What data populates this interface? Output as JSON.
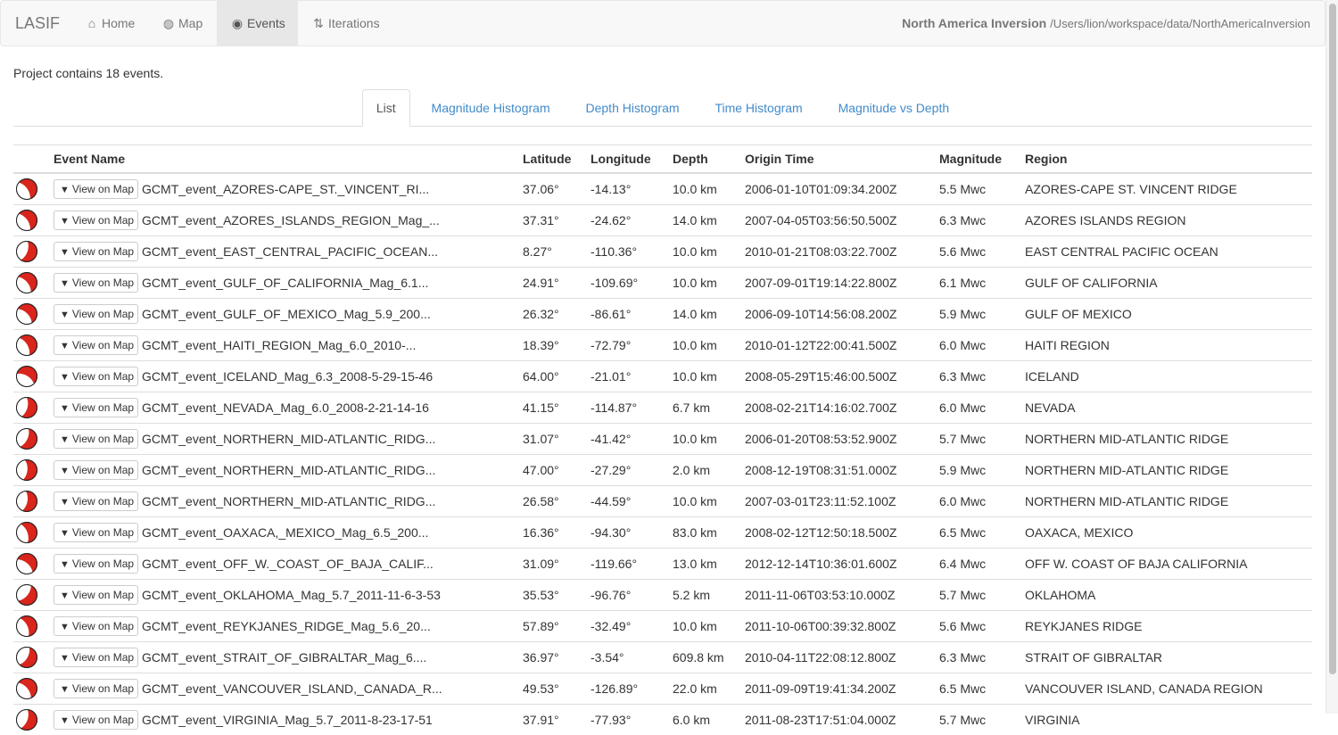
{
  "navbar": {
    "brand": "LASIF",
    "items": [
      {
        "label": "Home",
        "icon": "home-icon",
        "glyph": "⌂"
      },
      {
        "label": "Map",
        "icon": "globe-icon",
        "glyph": "◍"
      },
      {
        "label": "Events",
        "icon": "target-icon",
        "glyph": "◉"
      },
      {
        "label": "Iterations",
        "icon": "sort-icon",
        "glyph": "⇅"
      }
    ],
    "active": "Events",
    "project_name": "North America Inversion",
    "project_path": "/Users/lion/workspace/data/NorthAmericaInversion"
  },
  "summary": "Project contains 18 events.",
  "tabs": [
    "List",
    "Magnitude Histogram",
    "Depth Histogram",
    "Time Histogram",
    "Magnitude vs Depth"
  ],
  "active_tab": "List",
  "table": {
    "columns": [
      "",
      "Event Name",
      "Latitude",
      "Longitude",
      "Depth",
      "Origin Time",
      "Magnitude",
      "Region"
    ],
    "view_button_label": "View on Map",
    "colors": {
      "beachball_red": "#d9251c",
      "beachball_white": "#ffffff",
      "beachball_outline": "#222222"
    },
    "rows": [
      {
        "name": "GCMT_event_AZORES-CAPE_ST._VINCENT_RI...",
        "lat": "37.06°",
        "lon": "-14.13°",
        "depth": "10.0 km",
        "time": "2006-01-10T01:09:34.200Z",
        "mag": "5.5 Mwc",
        "region": "AZORES-CAPE ST. VINCENT RIDGE"
      },
      {
        "name": "GCMT_event_AZORES_ISLANDS_REGION_Mag_...",
        "lat": "37.31°",
        "lon": "-24.62°",
        "depth": "14.0 km",
        "time": "2007-04-05T03:56:50.500Z",
        "mag": "6.3 Mwc",
        "region": "AZORES ISLANDS REGION"
      },
      {
        "name": "GCMT_event_EAST_CENTRAL_PACIFIC_OCEAN...",
        "lat": "8.27°",
        "lon": "-110.36°",
        "depth": "10.0 km",
        "time": "2010-01-21T08:03:22.700Z",
        "mag": "5.6 Mwc",
        "region": "EAST CENTRAL PACIFIC OCEAN"
      },
      {
        "name": "GCMT_event_GULF_OF_CALIFORNIA_Mag_6.1...",
        "lat": "24.91°",
        "lon": "-109.69°",
        "depth": "10.0 km",
        "time": "2007-09-01T19:14:22.800Z",
        "mag": "6.1 Mwc",
        "region": "GULF OF CALIFORNIA"
      },
      {
        "name": "GCMT_event_GULF_OF_MEXICO_Mag_5.9_200...",
        "lat": "26.32°",
        "lon": "-86.61°",
        "depth": "14.0 km",
        "time": "2006-09-10T14:56:08.200Z",
        "mag": "5.9 Mwc",
        "region": "GULF OF MEXICO"
      },
      {
        "name": "GCMT_event_HAITI_REGION_Mag_6.0_2010-...",
        "lat": "18.39°",
        "lon": "-72.79°",
        "depth": "10.0 km",
        "time": "2010-01-12T22:00:41.500Z",
        "mag": "6.0 Mwc",
        "region": "HAITI REGION"
      },
      {
        "name": "GCMT_event_ICELAND_Mag_6.3_2008-5-29-15-46",
        "lat": "64.00°",
        "lon": "-21.01°",
        "depth": "10.0 km",
        "time": "2008-05-29T15:46:00.500Z",
        "mag": "6.3 Mwc",
        "region": "ICELAND"
      },
      {
        "name": "GCMT_event_NEVADA_Mag_6.0_2008-2-21-14-16",
        "lat": "41.15°",
        "lon": "-114.87°",
        "depth": "6.7 km",
        "time": "2008-02-21T14:16:02.700Z",
        "mag": "6.0 Mwc",
        "region": "NEVADA"
      },
      {
        "name": "GCMT_event_NORTHERN_MID-ATLANTIC_RIDG...",
        "lat": "31.07°",
        "lon": "-41.42°",
        "depth": "10.0 km",
        "time": "2006-01-20T08:53:52.900Z",
        "mag": "5.7 Mwc",
        "region": "NORTHERN MID-ATLANTIC RIDGE"
      },
      {
        "name": "GCMT_event_NORTHERN_MID-ATLANTIC_RIDG...",
        "lat": "47.00°",
        "lon": "-27.29°",
        "depth": "2.0 km",
        "time": "2008-12-19T08:31:51.000Z",
        "mag": "5.9 Mwc",
        "region": "NORTHERN MID-ATLANTIC RIDGE"
      },
      {
        "name": "GCMT_event_NORTHERN_MID-ATLANTIC_RIDG...",
        "lat": "26.58°",
        "lon": "-44.59°",
        "depth": "10.0 km",
        "time": "2007-03-01T23:11:52.100Z",
        "mag": "6.0 Mwc",
        "region": "NORTHERN MID-ATLANTIC RIDGE"
      },
      {
        "name": "GCMT_event_OAXACA,_MEXICO_Mag_6.5_200...",
        "lat": "16.36°",
        "lon": "-94.30°",
        "depth": "83.0 km",
        "time": "2008-02-12T12:50:18.500Z",
        "mag": "6.5 Mwc",
        "region": "OAXACA, MEXICO"
      },
      {
        "name": "GCMT_event_OFF_W._COAST_OF_BAJA_CALIF...",
        "lat": "31.09°",
        "lon": "-119.66°",
        "depth": "13.0 km",
        "time": "2012-12-14T10:36:01.600Z",
        "mag": "6.4 Mwc",
        "region": "OFF W. COAST OF BAJA CALIFORNIA"
      },
      {
        "name": "GCMT_event_OKLAHOMA_Mag_5.7_2011-11-6-3-53",
        "lat": "35.53°",
        "lon": "-96.76°",
        "depth": "5.2 km",
        "time": "2011-11-06T03:53:10.000Z",
        "mag": "5.7 Mwc",
        "region": "OKLAHOMA"
      },
      {
        "name": "GCMT_event_REYKJANES_RIDGE_Mag_5.6_20...",
        "lat": "57.89°",
        "lon": "-32.49°",
        "depth": "10.0 km",
        "time": "2011-10-06T00:39:32.800Z",
        "mag": "5.6 Mwc",
        "region": "REYKJANES RIDGE"
      },
      {
        "name": "GCMT_event_STRAIT_OF_GIBRALTAR_Mag_6....",
        "lat": "36.97°",
        "lon": "-3.54°",
        "depth": "609.8 km",
        "time": "2010-04-11T22:08:12.800Z",
        "mag": "6.3 Mwc",
        "region": "STRAIT OF GIBRALTAR"
      },
      {
        "name": "GCMT_event_VANCOUVER_ISLAND,_CANADA_R...",
        "lat": "49.53°",
        "lon": "-126.89°",
        "depth": "22.0 km",
        "time": "2011-09-09T19:41:34.200Z",
        "mag": "6.5 Mwc",
        "region": "VANCOUVER ISLAND, CANADA REGION"
      },
      {
        "name": "GCMT_event_VIRGINIA_Mag_5.7_2011-8-23-17-51",
        "lat": "37.91°",
        "lon": "-77.93°",
        "depth": "6.0 km",
        "time": "2011-08-23T17:51:04.000Z",
        "mag": "5.7 Mwc",
        "region": "VIRGINIA"
      }
    ]
  }
}
